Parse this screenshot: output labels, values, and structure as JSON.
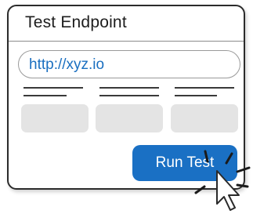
{
  "card": {
    "title": "Test Endpoint"
  },
  "url_input": {
    "value": "http://xyz.io"
  },
  "run_button": {
    "label": "Run Test"
  },
  "icons": {
    "cursor": "mouse-pointer-icon",
    "click_burst": "click-burst-icon"
  },
  "colors": {
    "accent": "#1a70c4",
    "url_text": "#1a6fc0",
    "tile": "#e4e4e4",
    "border": "#2b2b2b"
  }
}
